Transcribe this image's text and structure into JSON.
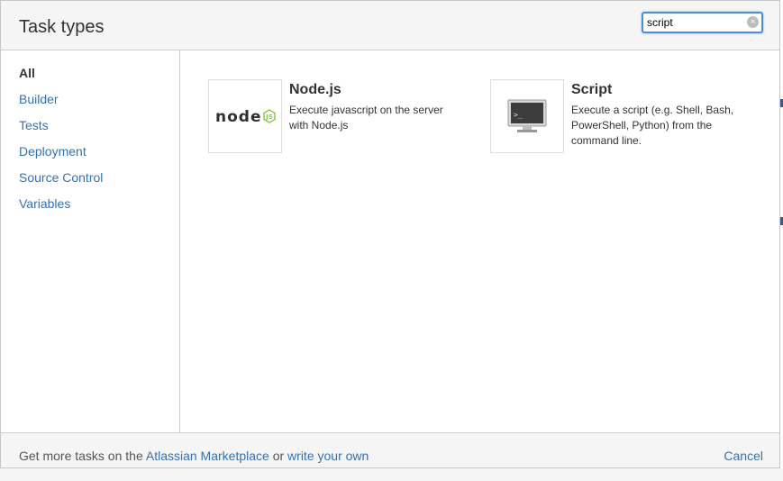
{
  "dialog": {
    "title": "Task types",
    "search": {
      "value": "script",
      "placeholder": ""
    }
  },
  "sidebar": {
    "items": [
      {
        "label": "All",
        "active": true
      },
      {
        "label": "Builder"
      },
      {
        "label": "Tests"
      },
      {
        "label": "Deployment"
      },
      {
        "label": "Source Control"
      },
      {
        "label": "Variables"
      }
    ]
  },
  "tasks": [
    {
      "name": "Node.js",
      "description": "Execute javascript on the server with Node.js",
      "logo_text": "node",
      "icon": "nodejs-logo-icon"
    },
    {
      "name": "Script",
      "description": "Execute a script (e.g. Shell, Bash, PowerShell, Python) from the command line.",
      "icon": "terminal-monitor-icon",
      "terminal_prompt": ">_"
    }
  ],
  "footer": {
    "prefix": "Get more tasks on the",
    "marketplace_link": "Atlassian Marketplace",
    "middle": "or",
    "write_link": "write your own",
    "cancel": "Cancel"
  },
  "colors": {
    "link": "#3572b0",
    "header_bg": "#f5f5f5",
    "border": "#cccccc",
    "search_focus": "#4a90d9",
    "node_green": "#8cc84b"
  }
}
